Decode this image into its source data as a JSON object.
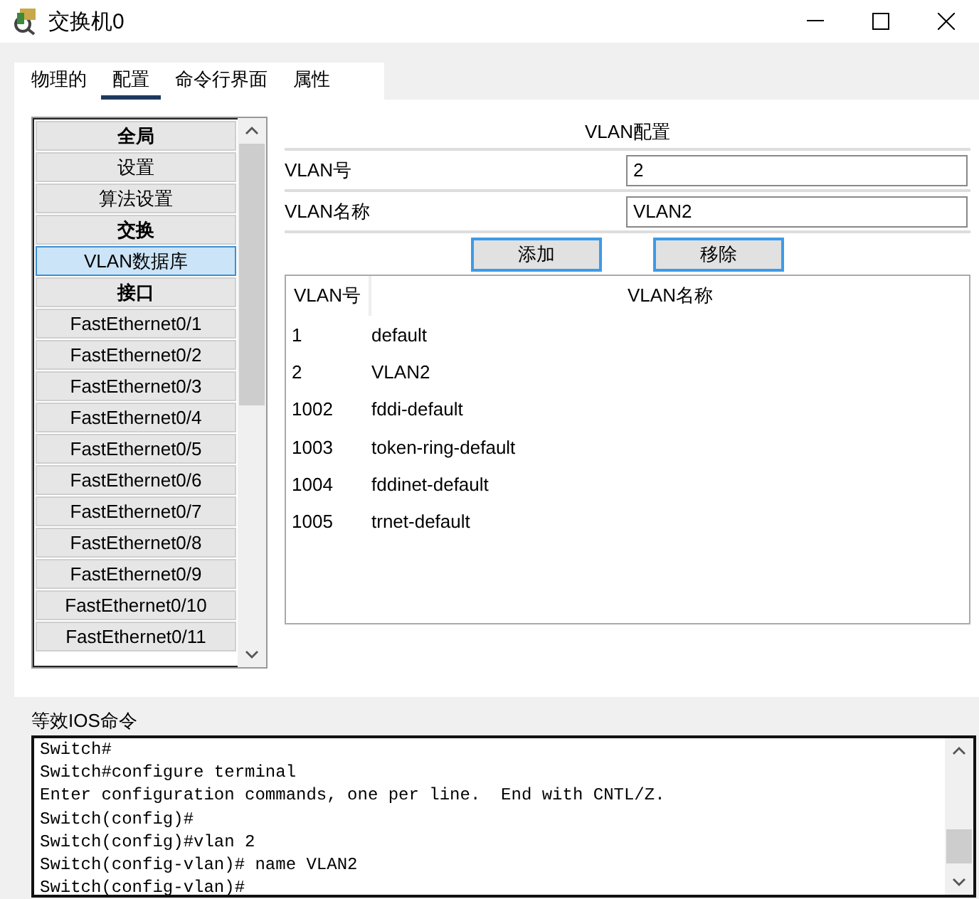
{
  "window": {
    "title": "交换机0"
  },
  "tabs": [
    {
      "label": "物理的",
      "selected": false
    },
    {
      "label": "配置",
      "selected": true
    },
    {
      "label": "命令行界面",
      "selected": false
    },
    {
      "label": "属性",
      "selected": false
    }
  ],
  "sidebar": {
    "items": [
      {
        "label": "全局",
        "kind": "header",
        "selected": false
      },
      {
        "label": "设置",
        "kind": "item",
        "selected": false
      },
      {
        "label": "算法设置",
        "kind": "item",
        "selected": false
      },
      {
        "label": "交换",
        "kind": "header",
        "selected": false
      },
      {
        "label": "VLAN数据库",
        "kind": "item",
        "selected": true
      },
      {
        "label": "接口",
        "kind": "header",
        "selected": false
      },
      {
        "label": "FastEthernet0/1",
        "kind": "item",
        "selected": false
      },
      {
        "label": "FastEthernet0/2",
        "kind": "item",
        "selected": false
      },
      {
        "label": "FastEthernet0/3",
        "kind": "item",
        "selected": false
      },
      {
        "label": "FastEthernet0/4",
        "kind": "item",
        "selected": false
      },
      {
        "label": "FastEthernet0/5",
        "kind": "item",
        "selected": false
      },
      {
        "label": "FastEthernet0/6",
        "kind": "item",
        "selected": false
      },
      {
        "label": "FastEthernet0/7",
        "kind": "item",
        "selected": false
      },
      {
        "label": "FastEthernet0/8",
        "kind": "item",
        "selected": false
      },
      {
        "label": "FastEthernet0/9",
        "kind": "item",
        "selected": false
      },
      {
        "label": "FastEthernet0/10",
        "kind": "item",
        "selected": false
      },
      {
        "label": "FastEthernet0/11",
        "kind": "item",
        "selected": false
      }
    ]
  },
  "vlan_config": {
    "title": "VLAN配置",
    "fields": [
      {
        "label": "VLAN号",
        "value": "2"
      },
      {
        "label": "VLAN名称",
        "value": "VLAN2"
      }
    ],
    "buttons": [
      "添加",
      "移除"
    ],
    "table": {
      "columns": [
        "VLAN号",
        "VLAN名称"
      ],
      "rows": [
        [
          "1",
          "default"
        ],
        [
          "2",
          "VLAN2"
        ],
        [
          "1002",
          "fddi-default"
        ],
        [
          "1003",
          "token-ring-default"
        ],
        [
          "1004",
          "fddinet-default"
        ],
        [
          "1005",
          "trnet-default"
        ]
      ]
    }
  },
  "ios_commands": {
    "label": "等效IOS命令",
    "lines": [
      "Switch#",
      "Switch#configure terminal",
      "Enter configuration commands, one per line.  End with CNTL/Z.",
      "Switch(config)#",
      "Switch(config)#vlan 2",
      "Switch(config-vlan)# name VLAN2",
      "Switch(config-vlan)#"
    ]
  }
}
